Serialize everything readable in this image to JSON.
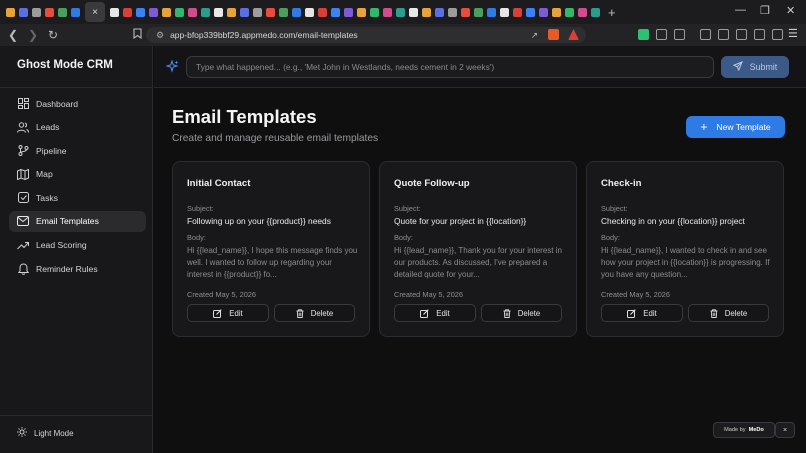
{
  "browser": {
    "url": "app-bfop339bbf29.appmedo.com/email-templates",
    "new_tab_glyph": "+",
    "active_tab_close_glyph": "×",
    "tab_favicons": [
      "#e8a23a",
      "#5a6ee6",
      "#9c9c9c",
      "#e84c3d",
      "#4aa05a",
      "#2f7be6",
      "#e6e6e6",
      "#d93f34",
      "#3b82f6",
      "#7d5bd6",
      "#e8a23a",
      "#32b86a",
      "#d24b8c",
      "#2a9d8f",
      "#e8e8e8"
    ],
    "ext_colors": [
      "#2fbf71",
      "#9c9c9c",
      "#9c9c9c",
      "#e45b2a",
      "#d93f34"
    ]
  },
  "app": {
    "brand": "Ghost Mode CRM",
    "command_placeholder": "Type what happened... (e.g., 'Met John in Westlands, needs cement in 2 weeks')",
    "submit_label": "Submit",
    "nav": [
      {
        "label": "Dashboard",
        "icon": "dashboard-icon",
        "active": false
      },
      {
        "label": "Leads",
        "icon": "users-icon",
        "active": false
      },
      {
        "label": "Pipeline",
        "icon": "pipeline-icon",
        "active": false
      },
      {
        "label": "Map",
        "icon": "map-icon",
        "active": false
      },
      {
        "label": "Tasks",
        "icon": "tasks-icon",
        "active": false
      },
      {
        "label": "Email Templates",
        "icon": "mail-icon",
        "active": true
      },
      {
        "label": "Lead Scoring",
        "icon": "trending-icon",
        "active": false
      },
      {
        "label": "Reminder Rules",
        "icon": "bell-icon",
        "active": false
      }
    ],
    "light_mode_label": "Light Mode"
  },
  "page": {
    "title": "Email Templates",
    "subtitle": "Create and manage reusable email templates",
    "new_button": "New Template",
    "subject_label": "Subject:",
    "body_label": "Body:",
    "edit_label": "Edit",
    "delete_label": "Delete",
    "templates": [
      {
        "name": "Initial Contact",
        "subject": "Following up on your {{product}} needs",
        "body": "Hi {{lead_name}}, I hope this message finds you well. I wanted to follow up regarding your interest in {{product}} fo...",
        "created": "Created May 5, 2026"
      },
      {
        "name": "Quote Follow-up",
        "subject": "Quote for your project in {{location}}",
        "body": "Hi {{lead_name}}, Thank you for your interest in our products. As discussed, I've prepared a detailed quote for your...",
        "created": "Created May 5, 2026"
      },
      {
        "name": "Check-in",
        "subject": "Checking in on your {{location}} project",
        "body": "Hi {{lead_name}}, I wanted to check in and see how your project in {{location}} is progressing. If you have any question...",
        "created": "Created May 5, 2026"
      }
    ]
  },
  "badge": {
    "made_by": "Made by",
    "brand": "MeDo",
    "close": "×"
  }
}
